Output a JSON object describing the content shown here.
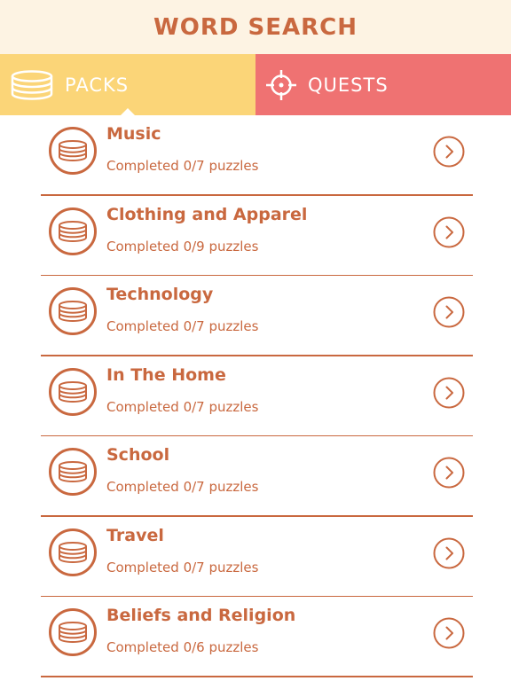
{
  "header": {
    "title": "WORD SEARCH"
  },
  "tabs": [
    {
      "label": "PACKS",
      "icon": "coin-stack-icon",
      "selected": true,
      "color": "#fbd578"
    },
    {
      "label": "QUESTS",
      "icon": "crosshair-icon",
      "selected": false,
      "color": "#ef7272"
    }
  ],
  "colors": {
    "accent": "#c9683f",
    "header_bg": "#fdf3e3"
  },
  "packs": [
    {
      "title": "Music",
      "subtitle": "Completed 0/7 puzzles"
    },
    {
      "title": "Clothing and Apparel",
      "subtitle": "Completed 0/9 puzzles"
    },
    {
      "title": "Technology",
      "subtitle": "Completed 0/7 puzzles"
    },
    {
      "title": "In The Home",
      "subtitle": "Completed 0/7 puzzles"
    },
    {
      "title": "School",
      "subtitle": "Completed 0/7 puzzles"
    },
    {
      "title": "Travel",
      "subtitle": "Completed 0/7 puzzles"
    },
    {
      "title": "Beliefs and Religion",
      "subtitle": "Completed 0/6 puzzles"
    }
  ]
}
